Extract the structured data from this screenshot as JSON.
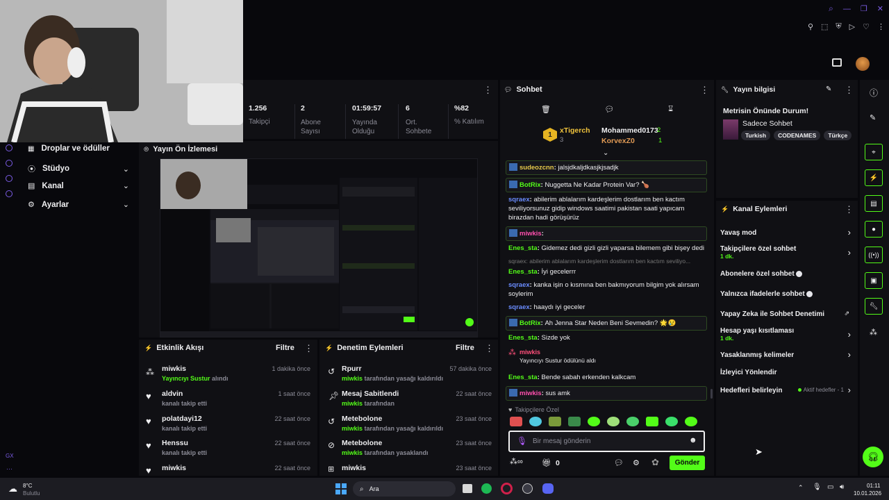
{
  "topbar": {
    "avatar": "avatar"
  },
  "stats": [
    {
      "value": "1.256",
      "label": "Takipçi"
    },
    {
      "value": "2",
      "label": "Abone Sayısı"
    },
    {
      "value": "01:59:57",
      "label": "Yayında Olduğu"
    },
    {
      "value": "6",
      "label": "Ort. Sohbete"
    },
    {
      "value": "%82",
      "label": "% Katılım"
    }
  ],
  "sidebar": {
    "items": [
      {
        "label": "Droplar ve ödüller"
      },
      {
        "label": "Stüdyo"
      },
      {
        "label": "Kanal"
      },
      {
        "label": "Ayarlar"
      }
    ],
    "bottom_label": "GX"
  },
  "preview": {
    "title": "Yayın Ön İzlemesi"
  },
  "activity": {
    "title": "Etkinlik Akışı",
    "filter": "Filtre",
    "items": [
      {
        "name": "miwkis",
        "desc": "Yayıncıyı Sustur alındı",
        "highlight": "Yayıncıyı Sustur",
        "rest": " alındı",
        "time": "1 dakika önce"
      },
      {
        "name": "aldvin",
        "desc": "kanalı takip etti",
        "time": "1 saat önce"
      },
      {
        "name": "polatdayi12",
        "desc": "kanalı takip etti",
        "time": "22 saat önce"
      },
      {
        "name": "Henssu",
        "desc": "kanalı takip etti",
        "time": "22 saat önce"
      },
      {
        "name": "miwkis",
        "desc": "",
        "time": "22 saat önce"
      }
    ]
  },
  "moderation": {
    "title": "Denetim Eylemleri",
    "filter": "Filtre",
    "items": [
      {
        "title": "Rpurr",
        "actor": "miwkis",
        "rest": " tarafından yasağı kaldırıldı",
        "time": "57 dakika önce"
      },
      {
        "title": "Mesaj Sabitlendi",
        "actor": "miwkis",
        "rest": " tarafından",
        "time": "22 saat önce"
      },
      {
        "title": "Metebolone",
        "actor": "miwkis",
        "rest": " tarafından yasağı kaldırıldı",
        "time": "23 saat önce"
      },
      {
        "title": "Metebolone",
        "actor": "miwkis",
        "rest": " tarafından yasaklandı",
        "time": "23 saat önce"
      },
      {
        "title": "miwkis",
        "actor": "",
        "rest": "",
        "time": "23 saat önce"
      }
    ]
  },
  "chat": {
    "title": "Sohbet",
    "leaderboard": {
      "first": "xTigerch",
      "first_count": "3",
      "second": "Mohammed0173",
      "second_count": "2",
      "third": "KorvexZ0",
      "third_count": "1"
    },
    "messages": [
      {
        "user": "sudeozcnn",
        "text": "jalsjdkaljdkasjkjsadjk",
        "color": "#e6c94a",
        "boxed": true
      },
      {
        "user": "BotRix",
        "text": "Nuggetta Ne Kadar Protein Var? 🍗",
        "color": "#53fc18",
        "boxed": true
      },
      {
        "user": "sqraex",
        "text": "abilerim ablalarım kardeşlerim dostlarım ben kactım seviliyorsunuz gidip windows saatimi pakistan saati yapıcam birazdan hadi görüşürüz",
        "color": "#6a8cff",
        "boxed": false
      },
      {
        "user": "miwkis",
        "text": "",
        "color": "#ff4fae",
        "boxed": true
      },
      {
        "user": "Enes_sta",
        "text": "Gidemez dedi gizli gizli yaparsa bilemem gibi bişey dedi",
        "color": "#53fc18",
        "boxed": false
      },
      {
        "user": "Enes_sta",
        "text": "İyi gecelerrr",
        "color": "#53fc18",
        "boxed": false,
        "reply": "sqraex: abilerim ablalarım kardeşlerim dostlarım ben kactım seviliyo..."
      },
      {
        "user": "sqraex",
        "text": "kanka işin o kısmına ben bakmıyorum bilgim yok alırsam soylerim",
        "color": "#6a8cff",
        "boxed": false
      },
      {
        "user": "sqraex",
        "text": "haaydı iyi geceler",
        "color": "#6a8cff",
        "boxed": false
      },
      {
        "user": "BotRix",
        "text": "Ah Jenna Star Neden Beni Sevmedin? 🌟😢",
        "color": "#53fc18",
        "boxed": true
      },
      {
        "user": "Enes_sta",
        "text": "Sizde yok",
        "color": "#53fc18",
        "boxed": false
      }
    ],
    "redeem": {
      "user": "miwkis",
      "text": "Yayıncıyı Sustur ödülünü aldı"
    },
    "after": [
      {
        "user": "Enes_sta",
        "text": "Bende sabah erkenden kalkcam",
        "color": "#53fc18",
        "boxed": false
      },
      {
        "user": "miwkis",
        "text": "sus amk",
        "color": "#ff4fae",
        "boxed": true
      }
    ],
    "emote_label": "Takipçilere Özel",
    "input_placeholder": "Bir mesaj gönderin",
    "count": "0",
    "send": "Gönder"
  },
  "stream_info": {
    "title": "Yayın bilgisi",
    "stream_title": "Metrisin Önünde Durum!",
    "category": "Sadece Sohbet",
    "tags": [
      "Turkish",
      "CODENAMES",
      "Türkçe"
    ]
  },
  "channel_actions": {
    "title": "Kanal Eylemleri",
    "items": [
      {
        "label": "Yavaş mod",
        "sub": "",
        "control": "chevron"
      },
      {
        "label": "Takipçilere özel sohbet",
        "sub": "1 dk.",
        "control": "chevron"
      },
      {
        "label": "Abonelere özel sohbet",
        "sub": "",
        "control": "toggle"
      },
      {
        "label": "Yalnızca ifadelerle sohbet",
        "sub": "",
        "control": "toggle"
      },
      {
        "label": "Yapay Zeka ile Sohbet Denetimi",
        "sub": "",
        "control": "external"
      },
      {
        "label": "Hesap yaşı kısıtlaması",
        "sub": "1 dk.",
        "control": "chevron"
      },
      {
        "label": "Yasaklanmış kelimeler",
        "sub": "",
        "control": "chevron"
      },
      {
        "label": "İzleyici Yönlendir",
        "sub": "",
        "control": "none"
      },
      {
        "label": "Hedefleri belirleyin",
        "sub": "",
        "control": "chevron",
        "status": "Aktif hedefler - 1"
      }
    ]
  },
  "taskbar": {
    "weather_temp": "8°C",
    "weather_desc": "Bulutlu",
    "search": "Ara",
    "time": "01:11",
    "date": "10.01.2026"
  },
  "colors": {
    "accent": "#53fc18",
    "bg": "#08080c",
    "panel": "#101014"
  }
}
